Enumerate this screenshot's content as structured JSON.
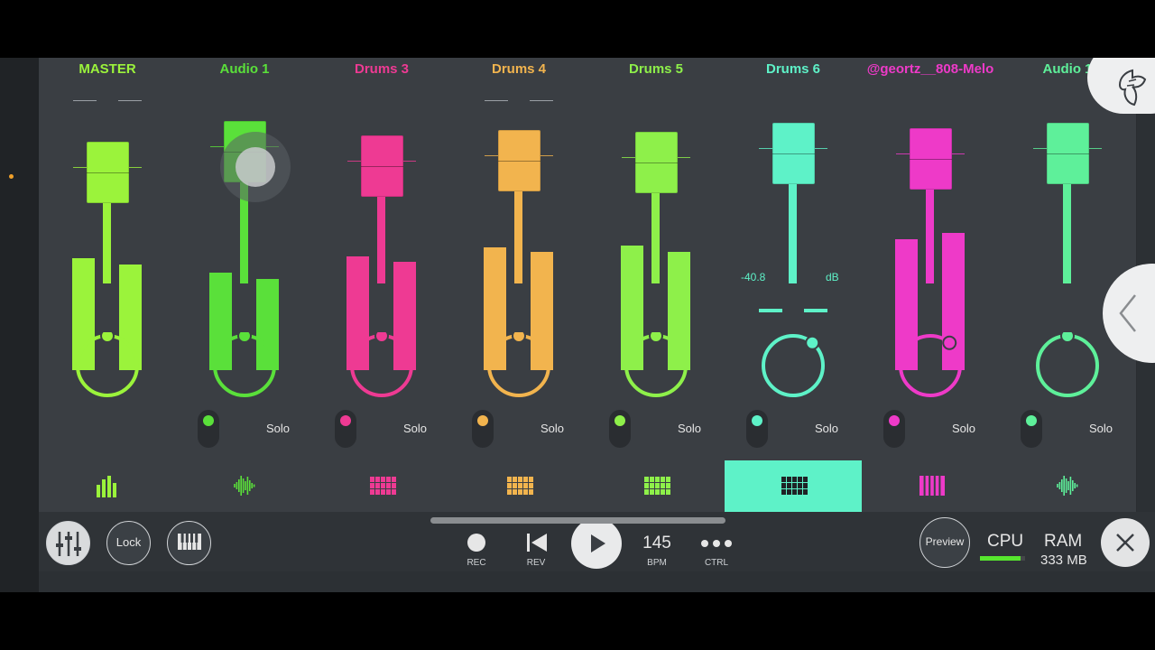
{
  "channels": [
    {
      "name": "MASTER",
      "color": "#9bf33b",
      "meter_l": 0.54,
      "meter_r": 0.51,
      "fader": 0.73,
      "knob_angle": 0,
      "active": false,
      "has_solo": false,
      "icon": "meter-bars-icon",
      "peaks": true
    },
    {
      "name": "Audio 1",
      "color": "#5ae03a",
      "meter_l": 0.47,
      "meter_r": 0.44,
      "fader": 0.84,
      "knob_angle": 0,
      "active": false,
      "has_solo": true,
      "icon": "waveform-icon",
      "peaks": false
    },
    {
      "name": "Drums 3",
      "color": "#ee3a93",
      "meter_l": 0.55,
      "meter_r": 0.52,
      "fader": 0.76,
      "knob_angle": 0,
      "active": false,
      "has_solo": true,
      "icon": "step-sequencer-icon",
      "peaks": false
    },
    {
      "name": "Drums 4",
      "color": "#f2b44e",
      "meter_l": 0.59,
      "meter_r": 0.57,
      "fader": 0.79,
      "knob_angle": 0,
      "active": false,
      "has_solo": true,
      "icon": "step-sequencer-icon",
      "peaks": true
    },
    {
      "name": "Drums 5",
      "color": "#8ef04a",
      "meter_l": 0.6,
      "meter_r": 0.57,
      "fader": 0.78,
      "knob_angle": 0,
      "active": false,
      "has_solo": true,
      "icon": "step-sequencer-icon",
      "peaks": false
    },
    {
      "name": "Drums 6",
      "color": "#5ef2c8",
      "meter_l": 0,
      "meter_r": 0,
      "fader": 0.83,
      "knob_angle": 40,
      "active": true,
      "has_solo": true,
      "icon": "step-sequencer-icon",
      "peaks": false
    },
    {
      "name": "@geortz__808-Melo",
      "color": "#ee3ac8",
      "meter_l": 0.63,
      "meter_r": 0.66,
      "fader": 0.8,
      "knob_angle": 40,
      "active": false,
      "has_solo": true,
      "icon": "piano-keys-icon",
      "peaks": false
    },
    {
      "name": "Audio 1",
      "color": "#5ef09a",
      "meter_l": 0,
      "meter_r": 0,
      "fader": 0.83,
      "knob_angle": 0,
      "active": false,
      "has_solo": true,
      "icon": "waveform-icon",
      "peaks": false
    }
  ],
  "solo_label": "Solo",
  "db_readout": {
    "value": "-40.8",
    "unit": "dB"
  },
  "bottom": {
    "lock_label": "Lock",
    "rec_label": "REC",
    "rev_label": "REV",
    "bpm_value": "145",
    "bpm_label": "BPM",
    "ctrl_label": "CTRL",
    "preview_label": "Preview",
    "cpu_label": "CPU",
    "cpu_load": 0.9,
    "ram_label": "RAM",
    "ram_value": "333 MB"
  }
}
